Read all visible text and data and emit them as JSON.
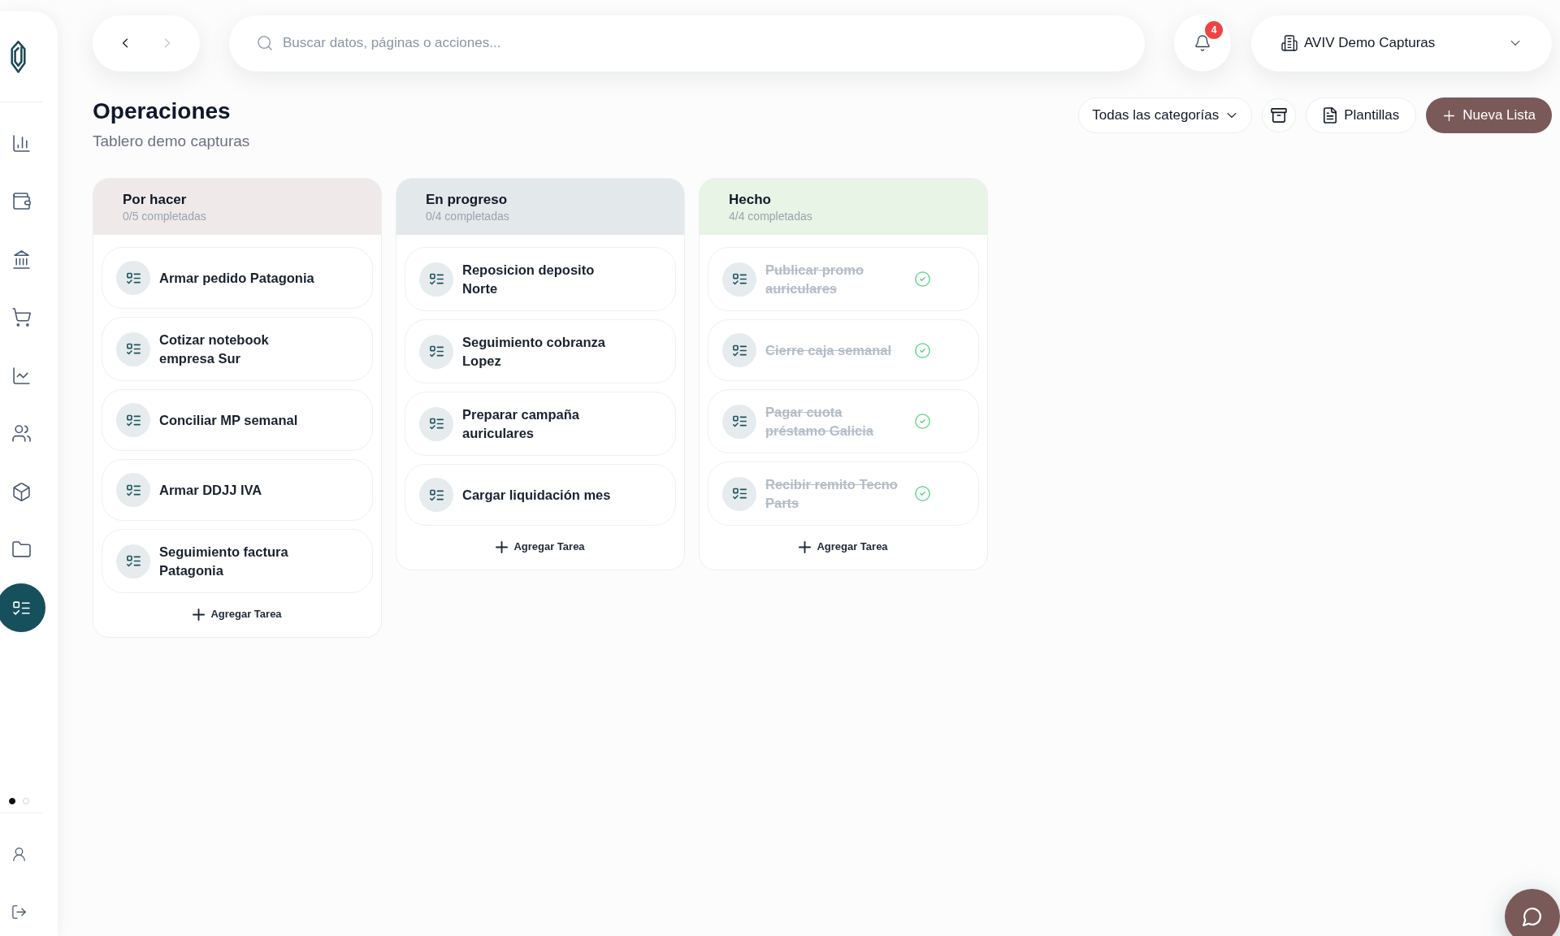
{
  "sidebar": {
    "nav_items": [
      {
        "selected": false
      },
      {
        "selected": false
      },
      {
        "selected": false
      },
      {
        "selected": false
      },
      {
        "selected": false
      },
      {
        "selected": false
      },
      {
        "selected": false
      },
      {
        "selected": false
      },
      {
        "selected": true
      }
    ],
    "pager": [
      {
        "selected": true
      },
      {
        "selected": false
      }
    ]
  },
  "top_bar": {
    "history": [
      {
        "disabled": false
      },
      {
        "disabled": true
      }
    ],
    "search": {
      "placeholder": "Buscar datos, páginas o acciones..."
    },
    "notifications": {
      "count": "4"
    },
    "company": {
      "name": "AVIV Demo Capturas"
    }
  },
  "header": {
    "title": "Operaciones",
    "subtitle": "Tablero demo capturas",
    "category_filter": "Todas las categorías",
    "templates_button": "Plantillas",
    "new_list_button": "Nueva Lista"
  },
  "board": {
    "columns": [
      {
        "title": "Por hacer",
        "progress": "0/5 completadas",
        "color": "#efeae9",
        "tasks": [
          {
            "title": "Armar pedido Patagonia",
            "done": false
          },
          {
            "title": "Cotizar notebook empresa Sur",
            "done": false
          },
          {
            "title": "Conciliar MP semanal",
            "done": false
          },
          {
            "title": "Armar DDJJ IVA",
            "done": false
          },
          {
            "title": "Seguimiento factura Patagonia",
            "done": false
          }
        ],
        "add_label": "Agregar Tarea"
      },
      {
        "title": "En progreso",
        "progress": "0/4 completadas",
        "color": "#e3e8eb",
        "tasks": [
          {
            "title": "Reposicion deposito Norte",
            "done": false
          },
          {
            "title": "Seguimiento cobranza Lopez",
            "done": false
          },
          {
            "title": "Preparar campaña auriculares",
            "done": false
          },
          {
            "title": "Cargar liquidación mes",
            "done": false
          }
        ],
        "add_label": "Agregar Tarea"
      },
      {
        "title": "Hecho",
        "progress": "4/4 completadas",
        "color": "#e7f4e6",
        "tasks": [
          {
            "title": "Publicar promo auriculares",
            "done": true
          },
          {
            "title": "Cierre caja semanal",
            "done": true
          },
          {
            "title": "Pagar cuota préstamo Galicia",
            "done": true
          },
          {
            "title": "Recibir remito Tecno Parts",
            "done": true
          }
        ],
        "add_label": "Agregar Tarea"
      }
    ]
  }
}
